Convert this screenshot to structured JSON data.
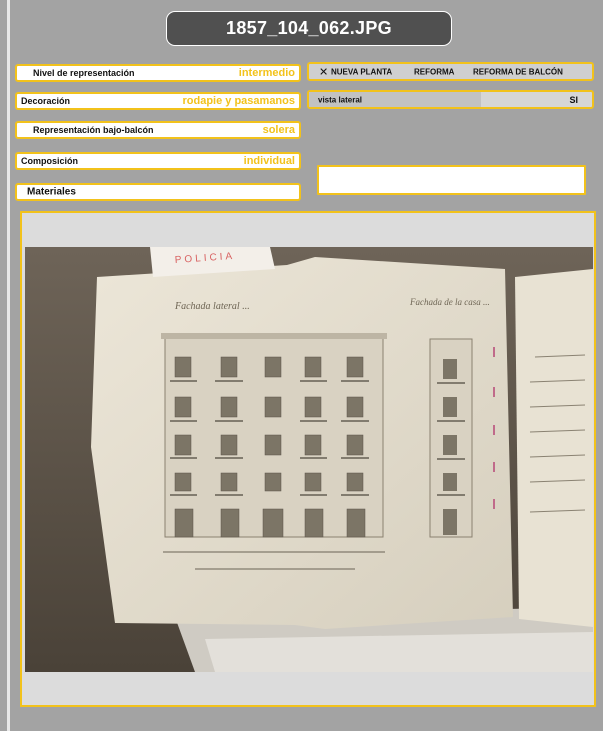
{
  "title": "1857_104_062.JPG",
  "fields": {
    "nivel": {
      "label": "Nivel de representación",
      "value": "intermedio"
    },
    "decoracion": {
      "label": "Decoración",
      "value": "rodapie y pasamanos"
    },
    "bajo_balcon": {
      "label": "Representación bajo-balcón",
      "value": "solera"
    },
    "composicion": {
      "label": "Composición",
      "value": "individual"
    },
    "materiales": {
      "label": "Materiales",
      "value": ""
    }
  },
  "tipo": {
    "mark": "✕",
    "options": [
      "NUEVA PLANTA",
      "REFORMA",
      "REFORMA DE BALCÓN"
    ]
  },
  "vista": {
    "label": "vista lateral",
    "value": "SI"
  },
  "notes_value": "",
  "photo": {
    "stamp_text": "POLICIA",
    "heading_left": "Fachada lateral ...",
    "heading_right": "Fachada de la casa ...",
    "colors": {
      "accent": "#f2c21b",
      "panel": "#a3a3a3",
      "title_bg": "#505050"
    }
  }
}
